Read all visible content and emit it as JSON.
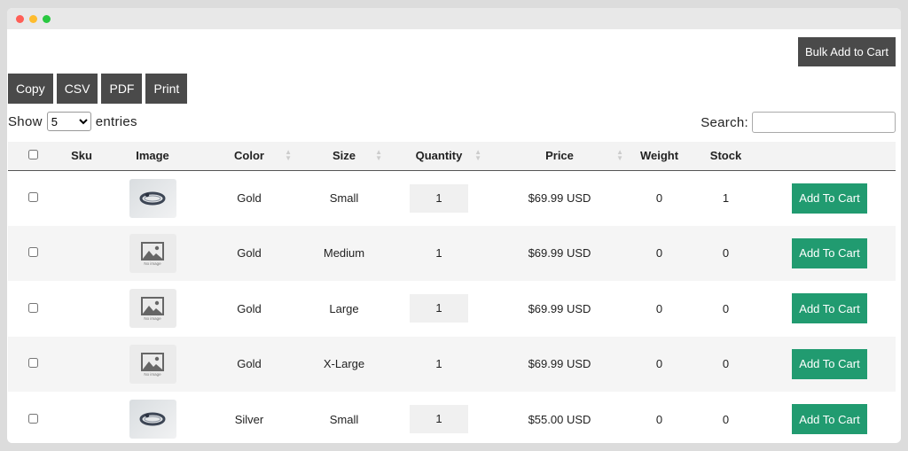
{
  "toolbar": {
    "bulk_label": "Bulk Add to Cart"
  },
  "export_buttons": [
    "Copy",
    "CSV",
    "PDF",
    "Print"
  ],
  "length": {
    "show_label": "Show",
    "selected": "5",
    "entries_label": "entries"
  },
  "search": {
    "label": "Search:",
    "value": ""
  },
  "columns": [
    "Sku",
    "Image",
    "Color",
    "Size",
    "Quantity",
    "Price",
    "Weight",
    "Stock"
  ],
  "rows": [
    {
      "sku": "",
      "image": "ring-photo",
      "color": "Gold",
      "size": "Small",
      "quantity": "1",
      "price": "$69.99 USD",
      "weight": "0",
      "stock": "1",
      "action": "Add To Cart"
    },
    {
      "sku": "",
      "image": "no-image",
      "color": "Gold",
      "size": "Medium",
      "quantity": "1",
      "price": "$69.99 USD",
      "weight": "0",
      "stock": "0",
      "action": "Add To Cart"
    },
    {
      "sku": "",
      "image": "no-image",
      "color": "Gold",
      "size": "Large",
      "quantity": "1",
      "price": "$69.99 USD",
      "weight": "0",
      "stock": "0",
      "action": "Add To Cart"
    },
    {
      "sku": "",
      "image": "no-image",
      "color": "Gold",
      "size": "X-Large",
      "quantity": "1",
      "price": "$69.99 USD",
      "weight": "0",
      "stock": "0",
      "action": "Add To Cart"
    },
    {
      "sku": "",
      "image": "ring-photo",
      "color": "Silver",
      "size": "Small",
      "quantity": "1",
      "price": "$55.00 USD",
      "weight": "0",
      "stock": "0",
      "action": "Add To Cart"
    }
  ],
  "no_image_text": "No image",
  "colors": {
    "button_dark": "#4a4a4a",
    "add_to_cart": "#219b70"
  }
}
